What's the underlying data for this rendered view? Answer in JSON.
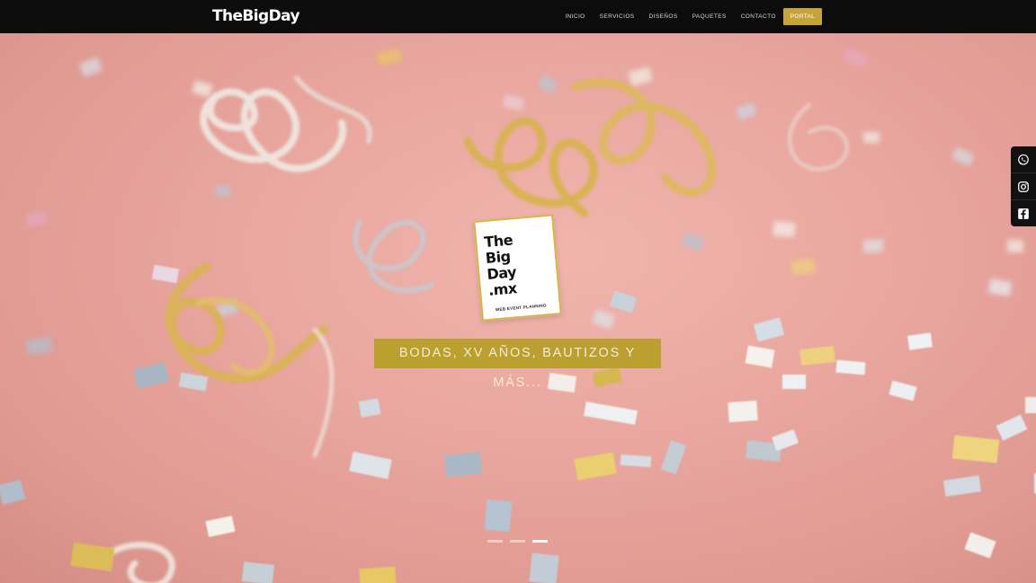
{
  "brand": {
    "name": "TheBigDay"
  },
  "nav": {
    "items": [
      "INICIO",
      "SERVICIOS",
      "DISEÑOS",
      "PAQUETES",
      "CONTACTO"
    ],
    "portal": "PORTAL"
  },
  "hero": {
    "logo_text": [
      "The",
      "Big",
      "Day",
      ".mx"
    ],
    "logo_sub": "WEB EVENT PLANNING",
    "tagline": "BODAS, XV AÑOS, BAUTIZOS Y MÁS...",
    "slides_total": 3,
    "slide_active": 3
  },
  "social": [
    "whatsapp-icon",
    "instagram-icon",
    "facebook-icon"
  ],
  "colors": {
    "navbar": "#0c0c0c",
    "accent_gold": "#c7a437",
    "hero_pink": "#e8a59d",
    "tagline_bg": "#b8a02a"
  }
}
